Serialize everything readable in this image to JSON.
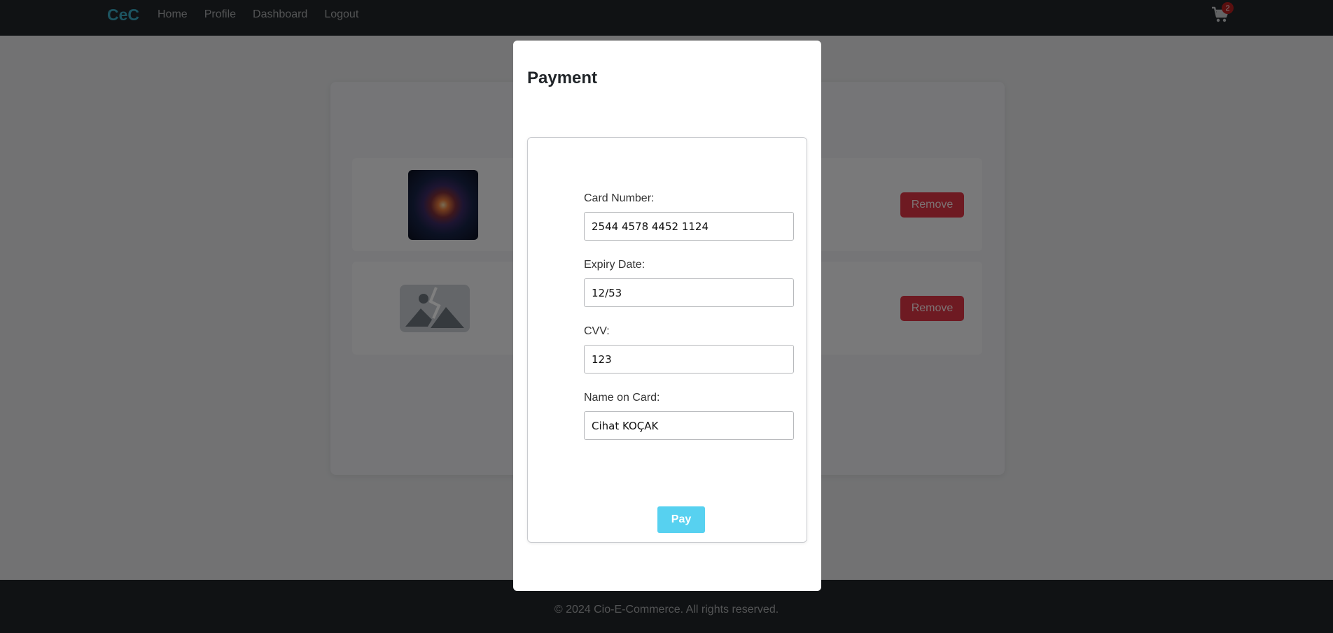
{
  "navbar": {
    "brand": "CeC",
    "links": [
      "Home",
      "Profile",
      "Dashboard",
      "Logout"
    ],
    "cart_count": "2",
    "cart_icon": "shopping-cart-icon"
  },
  "cart": {
    "items": [
      {
        "thumb": "galaxy-image",
        "remove_label": "Remove"
      },
      {
        "thumb": "image-placeholder-icon",
        "remove_label": "Remove"
      }
    ]
  },
  "modal": {
    "title": "Payment",
    "fields": {
      "card_number": {
        "label": "Card Number:",
        "value": "2544 4578 4452 1124"
      },
      "expiry": {
        "label": "Expiry Date:",
        "value": "12/53"
      },
      "cvv": {
        "label": "CVV:",
        "value": "123"
      },
      "name": {
        "label": "Name on Card:",
        "value": "Cihat KOÇAK"
      }
    },
    "pay_label": "Pay"
  },
  "footer": {
    "text": "© 2024 Cio-E-Commerce. All rights reserved."
  },
  "colors": {
    "brand": "#3aa8c1",
    "danger": "#dc3545",
    "pay": "#57d1f0",
    "navbar": "#212529"
  }
}
